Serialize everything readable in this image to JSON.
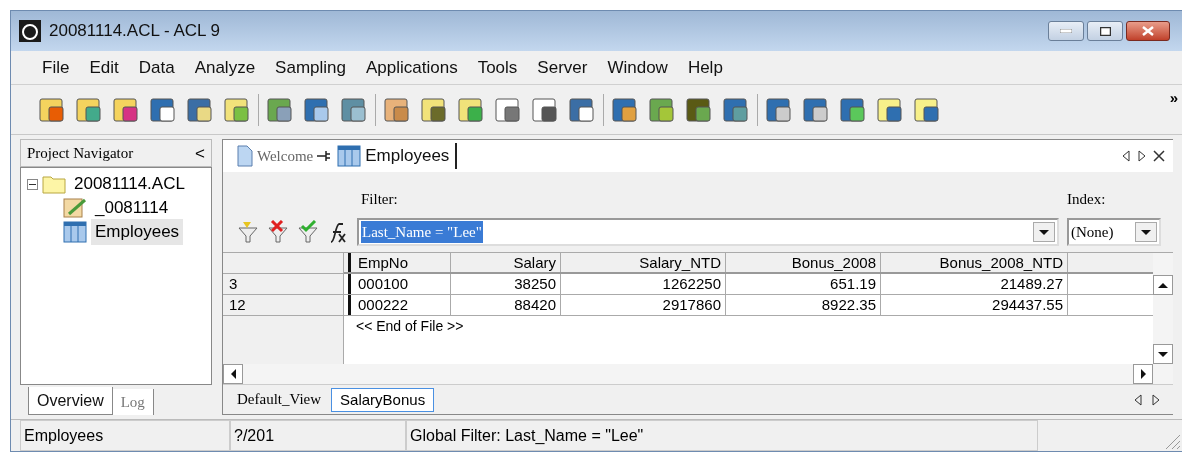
{
  "window": {
    "title": "20081114.ACL - ACL 9"
  },
  "menu": [
    "File",
    "Edit",
    "Data",
    "Analyze",
    "Sampling",
    "Applications",
    "Tools",
    "Server",
    "Window",
    "Help"
  ],
  "toolbar_overflow": "»",
  "navigator": {
    "title": "Project Navigator",
    "collapse": "<",
    "tree": [
      {
        "label": "20081114.ACL",
        "kind": "folder",
        "expanded": true,
        "selected": false,
        "children": [
          {
            "label": "_0081114",
            "kind": "script",
            "selected": false
          },
          {
            "label": "Employees",
            "kind": "table",
            "selected": true
          }
        ]
      }
    ],
    "tabs": [
      {
        "label": "Overview",
        "selected": true
      },
      {
        "label": "Log",
        "selected": false
      }
    ]
  },
  "doc_tabs": [
    {
      "label": "Welcome",
      "kind": "page",
      "selected": false
    },
    {
      "label": "Employees",
      "kind": "table",
      "selected": true
    }
  ],
  "filter": {
    "label": "Filter:",
    "value": "Last_Name = \"Lee\""
  },
  "index": {
    "label": "Index:",
    "value": "(None)"
  },
  "table": {
    "columns": [
      "EmpNo",
      "Salary",
      "Salary_NTD",
      "Bonus_2008",
      "Bonus_2008_NTD"
    ],
    "rows": [
      {
        "record": "3",
        "cells": [
          "000100",
          "38250",
          "1262250",
          "651.19",
          "21489.27"
        ]
      },
      {
        "record": "12",
        "cells": [
          "000222",
          "88420",
          "2917860",
          "8922.35",
          "294437.55"
        ]
      }
    ],
    "end_marker": "<< End of File >>"
  },
  "views": [
    {
      "label": "Default_View",
      "selected": false
    },
    {
      "label": "SalaryBonus",
      "selected": true
    }
  ],
  "status_bar": [
    "Employees",
    "?/201",
    "Global Filter: Last_Name = \"Lee\""
  ]
}
